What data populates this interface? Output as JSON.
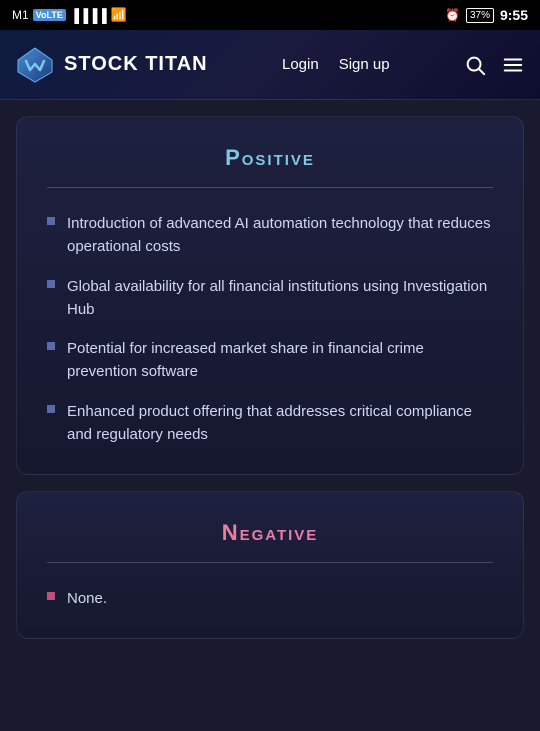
{
  "status_bar": {
    "carrier": "M1",
    "volte": "VoLTE",
    "signal": "signal",
    "wifi": "wifi",
    "alarm": "alarm",
    "battery": "37",
    "time": "9:55"
  },
  "navbar": {
    "logo_text": "STOCK TITAN",
    "login_label": "Login",
    "signup_label": "Sign up",
    "search_icon": "search",
    "menu_icon": "menu"
  },
  "positive_section": {
    "title": "Positive",
    "items": [
      "Introduction of advanced AI automation technology that reduces operational costs",
      "Global availability for all financial institutions using Investigation Hub",
      "Potential for increased market share in financial crime prevention software",
      "Enhanced product offering that addresses critical compliance and regulatory needs"
    ]
  },
  "negative_section": {
    "title": "Negative",
    "items": [
      "None."
    ]
  }
}
